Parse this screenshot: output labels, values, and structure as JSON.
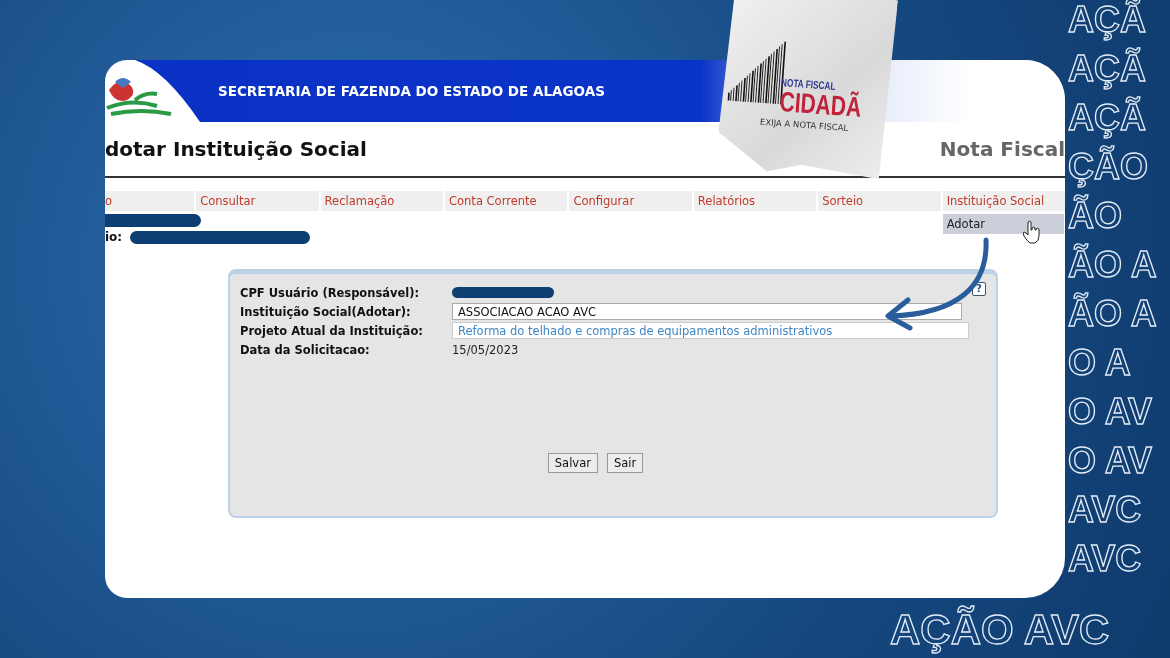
{
  "banner": {
    "title": "SECRETARIA DE FAZENDA DO ESTADO DE ALAGOAS"
  },
  "page_title": "dotar Instituição Social",
  "brand_title": "Nota Fiscal",
  "menu": [
    {
      "label": "o"
    },
    {
      "label": "Consultar"
    },
    {
      "label": "Reclamação"
    },
    {
      "label": "Conta Corrente"
    },
    {
      "label": "Configurar"
    },
    {
      "label": "Relatórios"
    },
    {
      "label": "Sorteio"
    },
    {
      "label": "Instituição Social",
      "children": [
        {
          "label": "Adotar",
          "selected": true
        }
      ]
    }
  ],
  "user_label": "io:",
  "form": {
    "help_icon": "?",
    "fields": [
      {
        "kind": "redacted",
        "label": "CPF Usuário (Responsável):"
      },
      {
        "kind": "input",
        "label": "Instituição Social(Adotar):",
        "value": "ASSOCIACAO ACAO AVC",
        "readonly": false
      },
      {
        "kind": "input",
        "label": "Projeto Atual da Instituição:",
        "value": "Reforma do telhado e compras de equipamentos administrativos",
        "readonly": true
      },
      {
        "kind": "text",
        "label": "Data da Solicitacao:",
        "value": "15/05/2023"
      }
    ],
    "buttons": [
      "Salvar",
      "Sair"
    ]
  },
  "sticker": {
    "title": "NOTA FISCAL",
    "name": "CIDADÃ",
    "tagline": "EXIJA A NOTA FISCAL"
  },
  "pattern_rows": [
    "AÇÃ",
    "AÇÃ",
    "AÇÃ",
    "ÇÃO",
    "ÃO",
    "ÃO A",
    "ÃO A",
    "O A",
    "O AV",
    "O AV",
    "AVC",
    "AVC"
  ],
  "slogan": "AÇÃO AVC"
}
